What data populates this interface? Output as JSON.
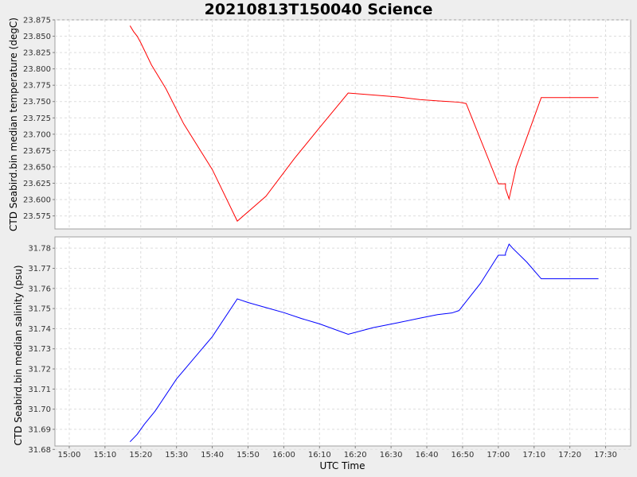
{
  "chart_data": [
    {
      "type": "line",
      "title": "20210813T150040 Science",
      "ylabel": "CTD Seabird.bin median temperature (degC)",
      "ylim": [
        23.555,
        23.875
      ],
      "yticks": [
        "23.575",
        "23.600",
        "23.625",
        "23.650",
        "23.675",
        "23.700",
        "23.725",
        "23.750",
        "23.775",
        "23.800",
        "23.825",
        "23.850",
        "23.875"
      ],
      "grid": true,
      "series": [
        {
          "color": "#ff0000",
          "x": [
            "15:17",
            "15:18",
            "15:19",
            "15:20",
            "15:23",
            "15:27",
            "15:32",
            "15:40",
            "15:47",
            "15:55",
            "16:03",
            "16:10",
            "16:18",
            "16:25",
            "16:32",
            "16:38",
            "16:43",
            "16:49",
            "16:51",
            "17:00",
            "17:02",
            "17:02",
            "17:03",
            "17:05",
            "17:12",
            "17:28"
          ],
          "y": [
            23.866,
            23.857,
            23.85,
            23.84,
            23.806,
            23.77,
            23.716,
            23.646,
            23.567,
            23.605,
            23.663,
            23.71,
            23.763,
            23.76,
            23.757,
            23.753,
            23.751,
            23.749,
            23.747,
            23.624,
            23.624,
            23.617,
            23.601,
            23.65,
            23.756,
            23.756
          ]
        }
      ]
    },
    {
      "type": "line",
      "ylabel": "CTD Seabird.bin median salinity (psu)",
      "ylim": [
        31.6817,
        31.7856
      ],
      "yticks": [
        "31.68",
        "31.69",
        "31.70",
        "31.71",
        "31.72",
        "31.73",
        "31.74",
        "31.75",
        "31.76",
        "31.77",
        "31.78"
      ],
      "xlabel": "UTC Time",
      "xticks": [
        "15:00",
        "15:10",
        "15:20",
        "15:30",
        "15:40",
        "15:50",
        "16:00",
        "16:10",
        "16:20",
        "16:30",
        "16:40",
        "16:50",
        "17:00",
        "17:10",
        "17:20",
        "17:30"
      ],
      "grid": true,
      "series": [
        {
          "color": "#0000ff",
          "x": [
            "15:17",
            "15:19",
            "15:21",
            "15:24",
            "15:30",
            "15:40",
            "15:47",
            "15:50",
            "15:55",
            "16:00",
            "16:05",
            "16:10",
            "16:18",
            "16:25",
            "16:32",
            "16:38",
            "16:43",
            "16:47",
            "16:49",
            "16:55",
            "17:00",
            "17:02",
            "17:02",
            "17:03",
            "17:04",
            "17:08",
            "17:12",
            "17:28"
          ],
          "y": [
            31.6838,
            31.6875,
            31.6925,
            31.699,
            31.715,
            31.736,
            31.7548,
            31.753,
            31.7505,
            31.748,
            31.745,
            31.7424,
            31.7372,
            31.7405,
            31.743,
            31.7452,
            31.747,
            31.7478,
            31.749,
            31.7625,
            31.7765,
            31.7765,
            31.7775,
            31.782,
            31.78,
            31.773,
            31.7648,
            31.7648
          ]
        }
      ]
    }
  ]
}
